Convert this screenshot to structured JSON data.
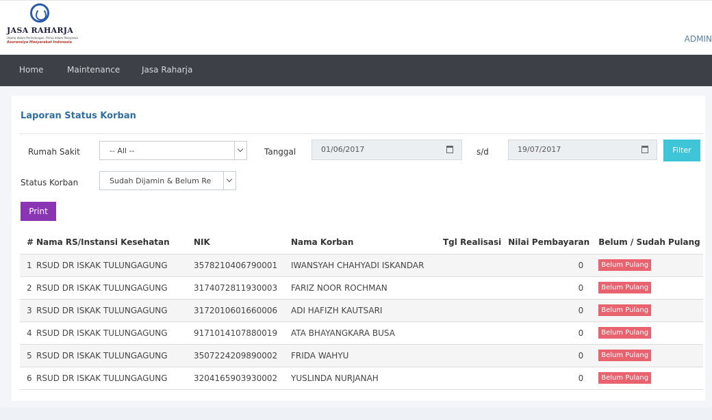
{
  "logo": {
    "brand": "JASA RAHARJA",
    "tagline": "Utama dalam Perlindungan, Prima dalam Pelayanan",
    "motto": "Asuransiya Masyarakat Indonesia"
  },
  "header": {
    "user": "ADMIN"
  },
  "nav": {
    "items": [
      "Home",
      "Maintenance",
      "Jasa Raharja"
    ]
  },
  "page": {
    "title": "Laporan Status Korban"
  },
  "filters": {
    "rumah_sakit_label": "Rumah Sakit",
    "rumah_sakit_value": "-- All --",
    "tanggal_label": "Tanggal",
    "date_from": "01/06/2017",
    "sd_label": "s/d",
    "date_to": "19/07/2017",
    "filter_button": "Filter",
    "status_label": "Status Korban",
    "status_value": "Sudah Dijamin & Belum Re"
  },
  "print_button": "Print",
  "table": {
    "headers": [
      "#",
      "Nama RS/Instansi Kesehatan",
      "NIK",
      "Nama Korban",
      "Tgl Realisasi",
      "Nilai Pembayaran",
      "Belum / Sudah Pulang"
    ],
    "rows": [
      {
        "no": "1",
        "rs": "RSUD DR ISKAK TULUNGAGUNG",
        "nik": "3578210406790001",
        "nama": "IWANSYAH CHAHYADI ISKANDAR",
        "tgl": "",
        "nilai": "0",
        "status": "Belum Pulang"
      },
      {
        "no": "2",
        "rs": "RSUD DR ISKAK TULUNGAGUNG",
        "nik": "3174072811930003",
        "nama": "FARIZ NOOR ROCHMAN",
        "tgl": "",
        "nilai": "0",
        "status": "Belum Pulang"
      },
      {
        "no": "3",
        "rs": "RSUD DR ISKAK TULUNGAGUNG",
        "nik": "3172010601660006",
        "nama": "ADI HAFIZH KAUTSARI",
        "tgl": "",
        "nilai": "0",
        "status": "Belum Pulang"
      },
      {
        "no": "4",
        "rs": "RSUD DR ISKAK TULUNGAGUNG",
        "nik": "9171014107880019",
        "nama": "ATA BHAYANGKARA BUSA",
        "tgl": "",
        "nilai": "0",
        "status": "Belum Pulang"
      },
      {
        "no": "5",
        "rs": "RSUD DR ISKAK TULUNGAGUNG",
        "nik": "3507224209890002",
        "nama": "FRIDA WAHYU",
        "tgl": "",
        "nilai": "0",
        "status": "Belum Pulang"
      },
      {
        "no": "6",
        "rs": "RSUD DR ISKAK TULUNGAGUNG",
        "nik": "3204165903930002",
        "nama": "YUSLINDA NURJANAH",
        "tgl": "",
        "nilai": "0",
        "status": "Belum Pulang"
      }
    ]
  },
  "colors": {
    "navbar": "#3d4147",
    "title": "#2f6ea0",
    "filter_button": "#3ec6d8",
    "print_button": "#8a35b3",
    "badge": "#e8636f"
  }
}
